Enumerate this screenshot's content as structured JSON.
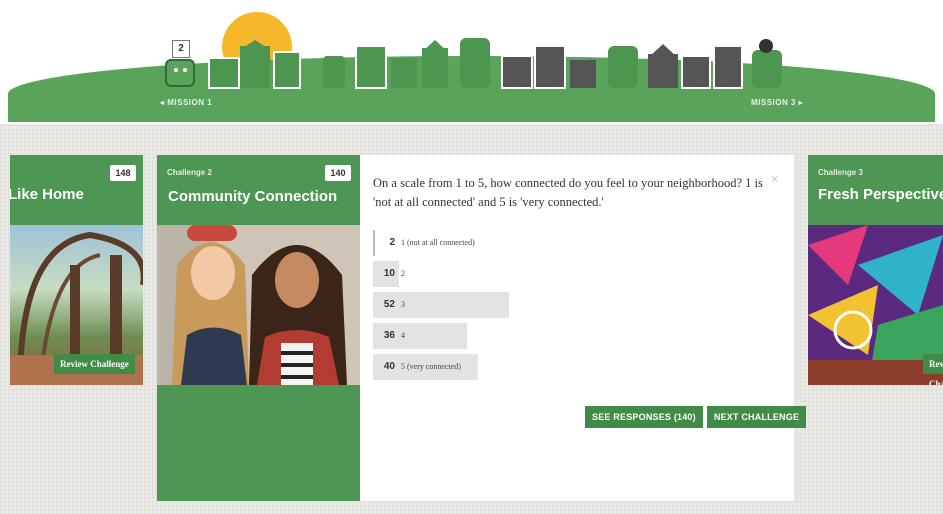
{
  "header": {
    "mission_prev": "◂ MISSION 1",
    "mission_next": "MISSION 3 ▸",
    "current_badge": "2"
  },
  "left_card": {
    "title": "Like Home",
    "count": "148",
    "review_button": "Review Challenge"
  },
  "main_card": {
    "eyebrow": "Challenge 2",
    "title": "Community Connection",
    "count": "140"
  },
  "right_card": {
    "eyebrow": "Challenge 3",
    "title": "Fresh Perspective",
    "review_button": "Review Challenge"
  },
  "question": {
    "text": "On a scale from 1 to 5, how connected do you feel to your neighborhood? 1 is 'not at all connected' and 5 is 'very connected.'",
    "close_icon": "×"
  },
  "chart_data": {
    "type": "bar",
    "categories": [
      "1 (not at all connected)",
      "2",
      "3",
      "4",
      "5 (very connected)"
    ],
    "values": [
      2,
      10,
      52,
      36,
      40
    ]
  },
  "actions": {
    "see_responses": "SEE RESPONSES (140)",
    "next_challenge": "NEXT CHALLENGE"
  },
  "colors": {
    "brand_green": "#4e9654",
    "button_green": "#3f8b47",
    "sun": "#f7b72b",
    "bar_gray": "#e3e3e3"
  }
}
